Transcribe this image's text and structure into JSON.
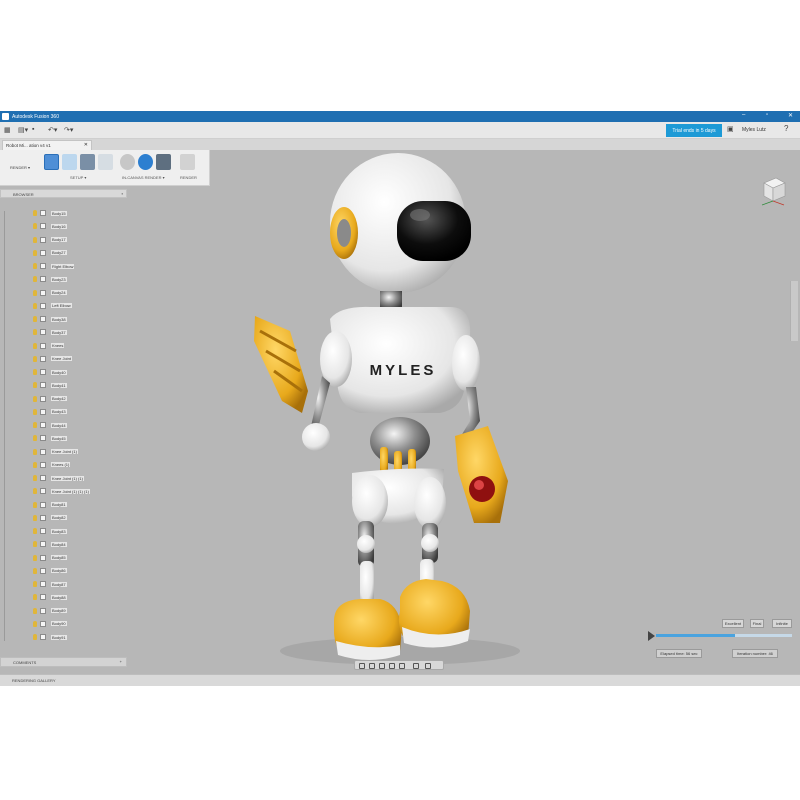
{
  "window": {
    "title": "Autodesk Fusion 360"
  },
  "quick_access": {
    "trial_text": "Trial ends in 5 days",
    "user_name": "Myles Lutz"
  },
  "document_tab": {
    "label": "Robot Mi... ation v4 v1"
  },
  "toolbar": {
    "workspace": "RENDER",
    "groups": [
      "SETUP",
      "IN-CANVAS RENDER",
      "RENDER"
    ]
  },
  "browser": {
    "title": "BROWSER",
    "items": [
      "Body15",
      "Body16",
      "Body17",
      "Body27",
      "Right Elbow",
      "Body23",
      "Body24",
      "Left Elbow",
      "Body38",
      "Body37",
      "Knees",
      "Knee Joint",
      "Body40",
      "Body41",
      "Body42",
      "Body43",
      "Body44",
      "Body45",
      "Knee Joint (1)",
      "Knees (1)",
      "Knee Joint (1) (1)",
      "Knee Joint (1) (1) (1)",
      "Body81",
      "Body82",
      "Body83",
      "Body84",
      "Body85",
      "Body86",
      "Body87",
      "Body88",
      "Body89",
      "Body90",
      "Body91"
    ]
  },
  "comments": {
    "label": "COMMENTS"
  },
  "gallery": {
    "label": "RENDERING GALLERY"
  },
  "robot": {
    "chest_text": "MYLES"
  },
  "render_panel": {
    "quality_buttons": [
      "Excellent",
      "Final",
      "Infinite"
    ],
    "progress": 0.58,
    "elapsed": "Elapsed time: 56 sec",
    "iteration": "Iteration number: 46"
  },
  "colors": {
    "title_blue": "#1f6fb2",
    "trial_blue": "#1d9ad6",
    "accent_yellow": "#e8b21f"
  }
}
